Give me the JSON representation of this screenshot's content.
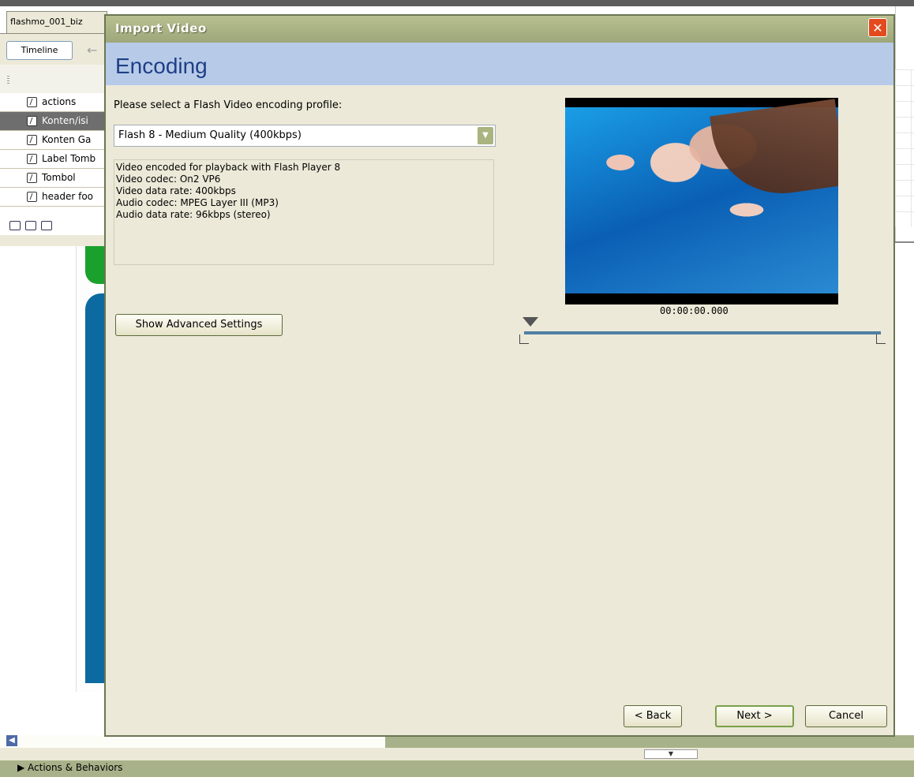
{
  "ide": {
    "doc_tab": "flashmo_001_biz",
    "timeline_button": "Timeline",
    "layers": [
      {
        "label": "actions",
        "selected": false
      },
      {
        "label": "Konten/isi",
        "selected": true
      },
      {
        "label": "Konten Ga",
        "selected": false
      },
      {
        "label": "Label Tomb",
        "selected": false
      },
      {
        "label": "Tombol",
        "selected": false
      },
      {
        "label": "header foo",
        "selected": false
      }
    ],
    "actions_panel": "Actions & Behaviors"
  },
  "dialog": {
    "title": "Import Video",
    "step_title": "Encoding",
    "prompt": "Please select a Flash Video encoding profile:",
    "profile_selected": "Flash 8 - Medium Quality (400kbps)",
    "info_lines": [
      "Video encoded for playback with Flash Player 8",
      "Video codec: On2 VP6",
      "Video data rate: 400kbps",
      "Audio codec: MPEG Layer III (MP3)",
      "Audio data rate: 96kbps (stereo)"
    ],
    "advanced_button": "Show Advanced Settings",
    "timecode": "00:00:00.000",
    "buttons": {
      "back": "< Back",
      "next": "Next >",
      "cancel": "Cancel"
    }
  },
  "colors": {
    "banner": "#b7cbe9",
    "title_accent": "#1f3f86",
    "close": "#e34a1e"
  }
}
